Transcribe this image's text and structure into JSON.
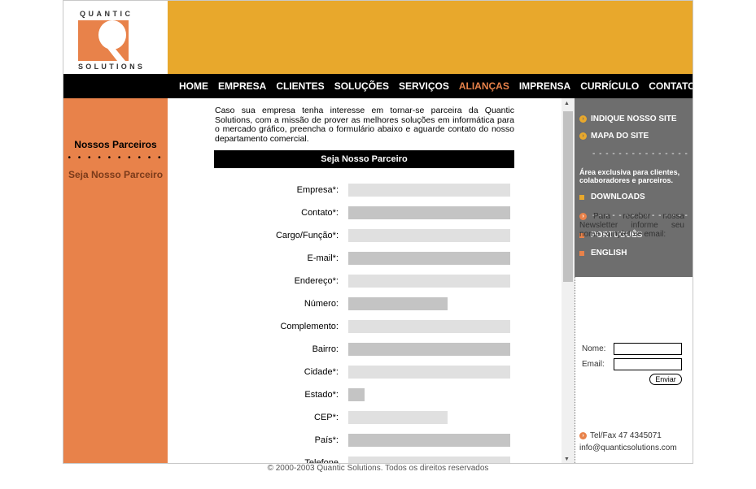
{
  "logo": {
    "top_text": "QUANTIC",
    "bottom_text": "SOLUTIONS"
  },
  "nav": {
    "items": [
      "HOME",
      "EMPRESA",
      "CLIENTES",
      "SOLUÇÕES",
      "SERVIÇOS",
      "ALIANÇAS",
      "IMPRENSA",
      "CURRÍCULO",
      "CONTATO"
    ],
    "active": "ALIANÇAS"
  },
  "left": {
    "title": "Nossos Parceiros",
    "dots": "• • • • • • • • • •",
    "link": "Seja Nosso Parceiro"
  },
  "main": {
    "intro": "Caso sua empresa tenha interesse em tornar-se parceira da Quantic Solutions, com a missão de prover as melhores soluções em informática para o mercado gráfico, preencha o formulário abaixo e aguarde contato do nosso departamento comercial.",
    "form_title": "Seja Nosso Parceiro",
    "fields": [
      {
        "label": "Empresa*:",
        "size": "long",
        "shade": "light"
      },
      {
        "label": "Contato*:",
        "size": "long",
        "shade": "dark"
      },
      {
        "label": "Cargo/Função*:",
        "size": "long",
        "shade": "light"
      },
      {
        "label": "E-mail*:",
        "size": "long",
        "shade": "dark"
      },
      {
        "label": "Endereço*:",
        "size": "long",
        "shade": "light"
      },
      {
        "label": "Número:",
        "size": "medium",
        "shade": "dark"
      },
      {
        "label": "Complemento:",
        "size": "long",
        "shade": "light"
      },
      {
        "label": "Bairro:",
        "size": "long",
        "shade": "dark"
      },
      {
        "label": "Cidade*:",
        "size": "long",
        "shade": "light"
      },
      {
        "label": "Estado*:",
        "size": "tiny",
        "shade": "dark"
      },
      {
        "label": "CEP*:",
        "size": "medium",
        "shade": "light"
      },
      {
        "label": "País*:",
        "size": "long",
        "shade": "dark"
      },
      {
        "label": "Telefone",
        "size": "long",
        "shade": "light"
      }
    ]
  },
  "right": {
    "links": [
      "INDIQUE NOSSO SITE",
      "MAPA DO SITE"
    ],
    "dashes": "- - - - - - - - - - - - - - -",
    "exclusive": "Área exclusiva para clientes, colaboradores e parceiros.",
    "downloads": "DOWNLOADS",
    "languages": [
      "PORTUGUÊS",
      "ENGLISH"
    ],
    "newsletter_text": "Para receber nossa Newsletter informe seu nome completo e email:",
    "name_label": "Nome:",
    "email_label": "Email:",
    "send_label": "Enviar",
    "tel": "Tel/Fax 47 4345071",
    "email": "info@quanticsolutions.com"
  },
  "footer": "© 2000-2003 Quantic Solutions. Todos os direitos reservados",
  "colors": {
    "banner": "#e8a82c",
    "left_col": "#e8824a",
    "right_gray": "#6e6e6e",
    "nav_active": "#e8824a"
  }
}
